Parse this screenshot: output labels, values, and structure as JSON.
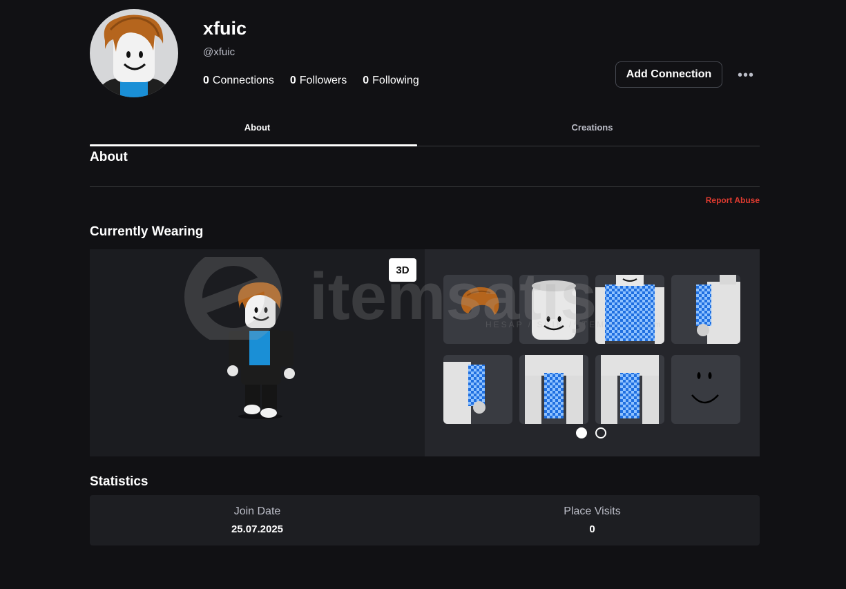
{
  "profile": {
    "display_name": "xfuic",
    "username": "@xfuic",
    "connections_count": "0",
    "connections_label": "Connections",
    "followers_count": "0",
    "followers_label": "Followers",
    "following_count": "0",
    "following_label": "Following"
  },
  "actions": {
    "add_connection_label": "Add Connection",
    "more_icon": "ellipsis-icon"
  },
  "tabs": [
    {
      "label": "About",
      "active": true
    },
    {
      "label": "Creations",
      "active": false
    }
  ],
  "about": {
    "title": "About",
    "report_label": "Report Abuse"
  },
  "wearing": {
    "title": "Currently Wearing",
    "view_toggle_label": "3D",
    "items": [
      {
        "name": "hair"
      },
      {
        "name": "head"
      },
      {
        "name": "shirt"
      },
      {
        "name": "left-arm"
      },
      {
        "name": "right-arm"
      },
      {
        "name": "left-leg"
      },
      {
        "name": "right-leg"
      },
      {
        "name": "face"
      }
    ],
    "pages": 2,
    "current_page": 1
  },
  "watermark": {
    "brand": "itemsatış",
    "tagline": "HESAP / SKIN / ITEM / ... .com"
  },
  "statistics": {
    "title": "Statistics",
    "join_date_label": "Join Date",
    "join_date_value": "25.07.2025",
    "place_visits_label": "Place Visits",
    "place_visits_value": "0"
  },
  "colors": {
    "background": "#111114",
    "accent_red": "#e03b30",
    "tile_bg": "#393b41"
  }
}
